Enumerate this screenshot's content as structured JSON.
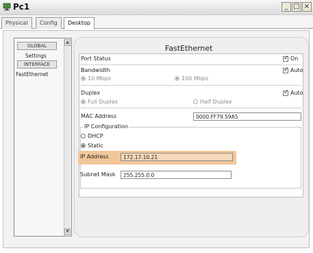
{
  "window": {
    "title": "Pc1"
  },
  "tabs": [
    {
      "label": "Physical"
    },
    {
      "label": "Config"
    },
    {
      "label": "Desktop"
    }
  ],
  "sidebar": {
    "global_label": "GLOBAL",
    "settings_label": "Settings",
    "interface_label": "INTERFACE",
    "fastethernet_label": "FastEthernet"
  },
  "panel": {
    "title": "FastEthernet",
    "port_status": {
      "label": "Port Status",
      "toggle_label": "On",
      "checked": true
    },
    "bandwidth": {
      "label": "Bandwidth",
      "auto_label": "Auto",
      "auto_checked": true,
      "options": [
        "10 Mbps",
        "100 Mbps"
      ]
    },
    "duplex": {
      "label": "Duplex",
      "auto_label": "Auto",
      "auto_checked": true,
      "options": [
        "Full Duplex",
        "Half Duplex"
      ]
    },
    "mac": {
      "label": "MAC Address",
      "value": "0000.FF79.59A5"
    },
    "ip_config": {
      "group_label": "IP Configuration",
      "dhcp_label": "DHCP",
      "static_label": "Static",
      "selected": "Static",
      "ip_label": "IP Address",
      "ip_value": "172.17.10.21",
      "subnet_label": "Subnet Mask",
      "subnet_value": "255.255.0.0"
    }
  },
  "colors": {
    "highlight": "#f1c79a",
    "panel": "#efefef"
  }
}
